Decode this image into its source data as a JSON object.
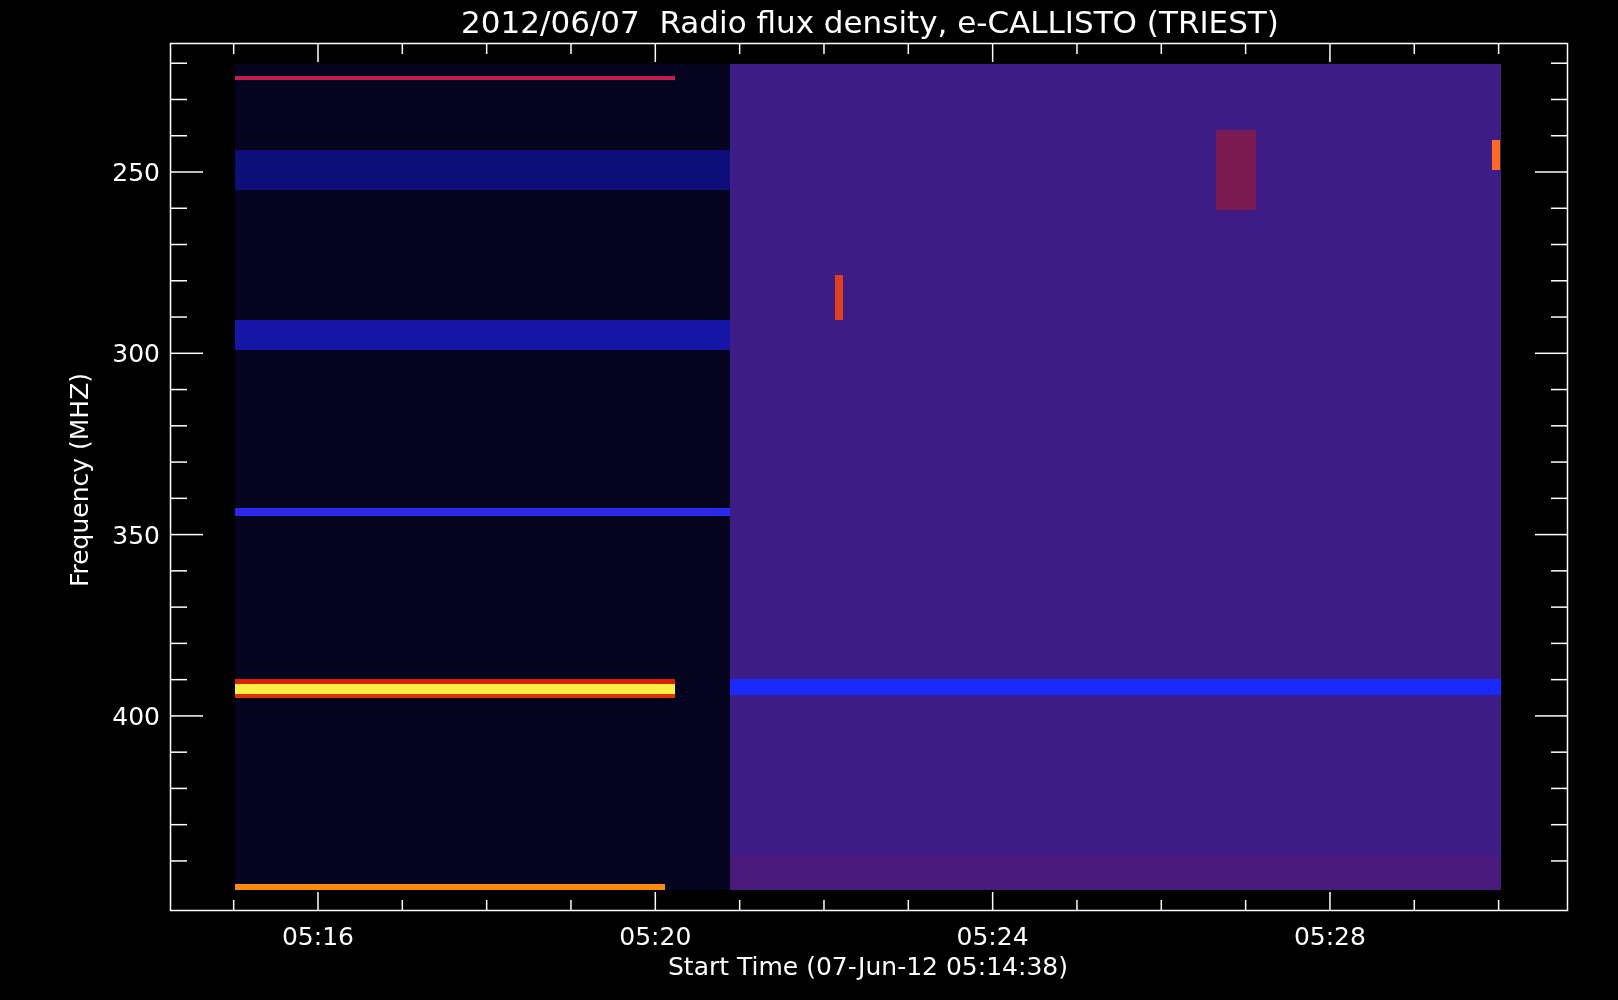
{
  "title": "2012/06/07  Radio flux density, e-CALLISTO (TRIEST)",
  "y_axis": {
    "label": "Frequency (MHZ)",
    "ticks": [
      "250",
      "300",
      "350",
      "400"
    ]
  },
  "x_axis": {
    "label": "Start Time (07-Jun-12 05:14:38)",
    "ticks": [
      "05:16",
      "05:20",
      "05:24",
      "05:28"
    ]
  }
}
